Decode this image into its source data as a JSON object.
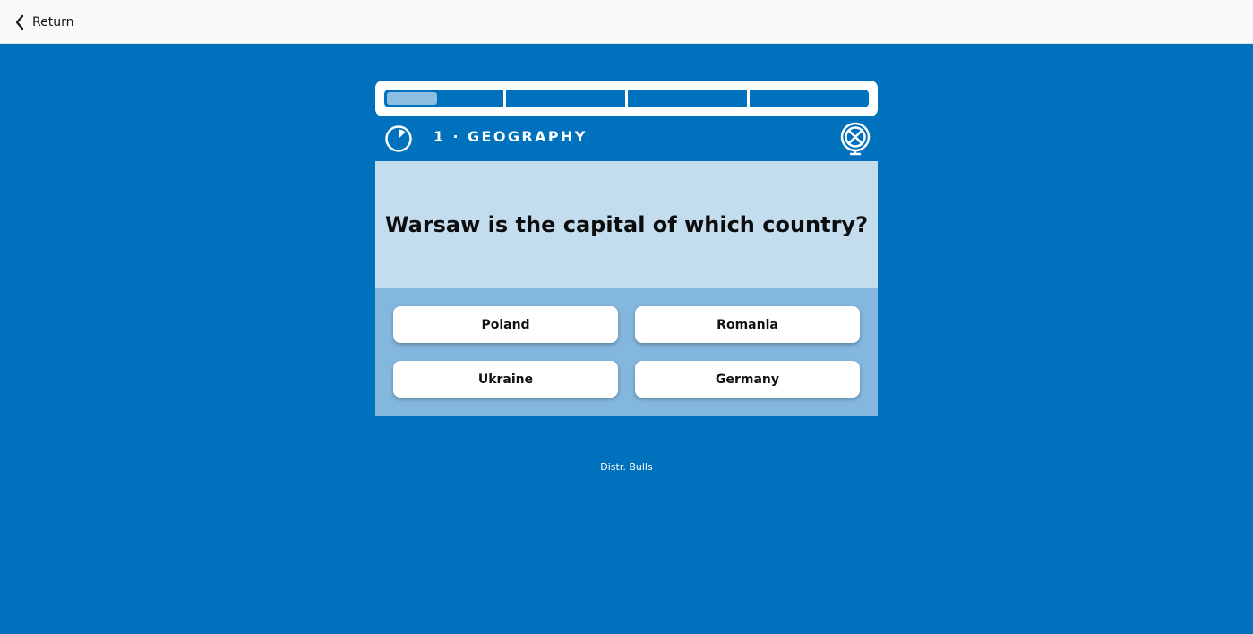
{
  "topbar": {
    "return_label": "Return",
    "back_icon": "chevron-left-icon"
  },
  "quiz": {
    "progress": {
      "segments": 4,
      "current_segment": 1,
      "current_segment_fill_fraction": 0.42
    },
    "question_number": "1",
    "category": "GEOGRAPHY",
    "header_label": "1 · GEOGRAPHY",
    "timer_icon": "timer-icon",
    "category_icon": "globe-icon",
    "question": "Warsaw is the capital of which country?",
    "answers": [
      "Poland",
      "Romania",
      "Ukraine",
      "Germany"
    ]
  },
  "footer": {
    "credit": "Distr. Bulls"
  },
  "colors": {
    "background": "#0071bc",
    "topbar": "#fafafa",
    "progress_fill": "#8dbde0",
    "question_panel": "#c3ddef",
    "answers_panel": "#84b7de",
    "answer_button": "#ffffff"
  }
}
